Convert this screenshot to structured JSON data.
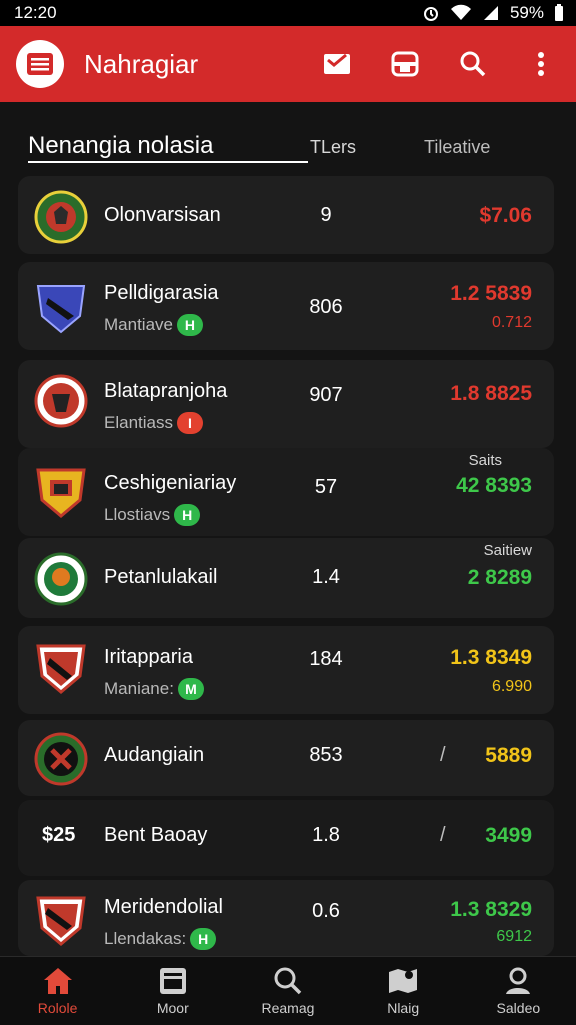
{
  "status_bar": {
    "time": "12:20",
    "battery": "59%"
  },
  "app_bar": {
    "title": "Nahragiar"
  },
  "list_header": {
    "title": "Nenangia nolasia",
    "col1": "TLers",
    "col2": "Tileative"
  },
  "rows": [
    {
      "name": "Olonvarsisan",
      "count": "9",
      "value": "$7.06",
      "value_color": "#e0392e"
    },
    {
      "name": "Pelldigarasia",
      "sub": "Mantiave",
      "badge": "H",
      "badge_color": "green",
      "count": "806",
      "value": "1.2 5839",
      "value_color": "#e0392e",
      "value2": "0.712",
      "value2_color": "#e0392e"
    },
    {
      "name": "Blatapranjoha",
      "sub": "Elantiass",
      "badge": "I",
      "badge_color": "red",
      "count": "907",
      "value": "1.8 8825",
      "value_color": "#e0392e"
    },
    {
      "name": "Ceshigeniariay",
      "sub": "Llostiavs",
      "badge": "H",
      "badge_color": "green",
      "count": "57",
      "value": "42 8393",
      "value_color": "#3ec84a",
      "top_label": "Saits"
    },
    {
      "name": "Petanlulakail",
      "count": "1.4",
      "value": "2 8289",
      "value_color": "#3ec84a",
      "top_label": "Saitiew"
    },
    {
      "name": "Iritapparia",
      "sub": "Maniane:",
      "badge": "M",
      "badge_color": "green",
      "count": "184",
      "value": "1.3 8349",
      "value_color": "#f1c419",
      "value2": "6.990",
      "value2_color": "#f1c419"
    },
    {
      "name": "Audangiain",
      "count": "853",
      "slash": "/",
      "value": "5889",
      "value_color": "#f1c419"
    },
    {
      "name": "Bent Baoay",
      "price": "$25",
      "count": "1.8",
      "slash": "/",
      "value": "3499",
      "value_color": "#3ec84a"
    },
    {
      "name": "Meridendolial",
      "sub": "Llendakas:",
      "badge": "H",
      "badge_color": "green",
      "count": "0.6",
      "value": "1.3 8329",
      "value_color": "#3ec84a",
      "value2": "6912",
      "value2_color": "#3ec84a"
    }
  ],
  "bottom_nav": [
    {
      "label": "Rolole",
      "icon": "home-icon"
    },
    {
      "label": "Moor",
      "icon": "inbox-icon"
    },
    {
      "label": "Reamag",
      "icon": "search-icon"
    },
    {
      "label": "Nlaig",
      "icon": "map-icon"
    },
    {
      "label": "Saldeo",
      "icon": "profile-icon"
    }
  ],
  "colors": {
    "accent": "#d32a2a",
    "positive": "#3ec84a",
    "negative": "#e0392e",
    "warning": "#f1c419"
  }
}
